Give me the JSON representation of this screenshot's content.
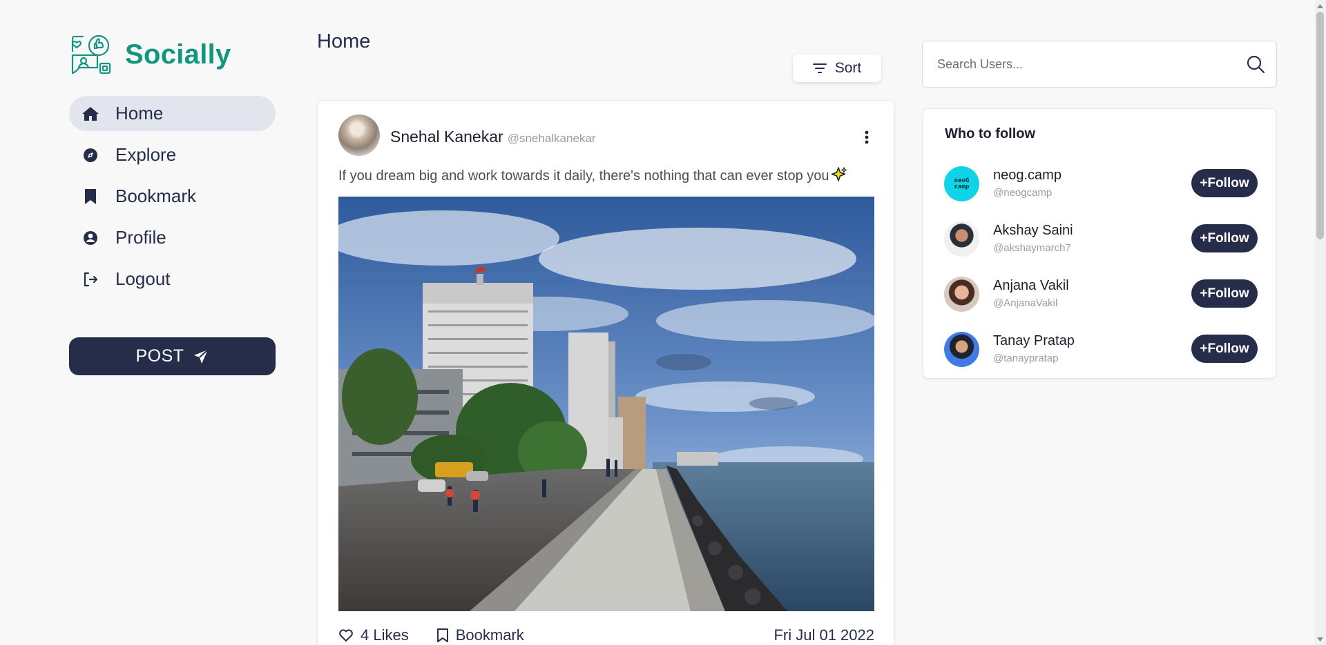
{
  "brand": {
    "name": "Socially",
    "logo_icon": "social-media-logo-icon",
    "color": "#12967f"
  },
  "nav": {
    "items": [
      {
        "label": "Home",
        "icon": "home-icon",
        "active": true
      },
      {
        "label": "Explore",
        "icon": "compass-icon",
        "active": false
      },
      {
        "label": "Bookmark",
        "icon": "bookmark-icon",
        "active": false
      },
      {
        "label": "Profile",
        "icon": "user-circle-icon",
        "active": false
      },
      {
        "label": "Logout",
        "icon": "logout-icon",
        "active": false
      }
    ],
    "post_label": "POST",
    "post_icon": "send-icon"
  },
  "main": {
    "title": "Home",
    "sort_label": "Sort",
    "post": {
      "author_name": "Snehal Kanekar",
      "author_handle": "@snehalkanekar",
      "text": "If you dream big and work towards it daily, there's nothing that can ever stop you",
      "emoji": "sparkles-icon",
      "likes_label": "4 Likes",
      "bookmark_label": "Bookmark",
      "date": "Fri Jul 01 2022"
    }
  },
  "search": {
    "placeholder": "Search Users..."
  },
  "who_to_follow": {
    "title": "Who to follow",
    "users": [
      {
        "name": "neog.camp",
        "handle": "@neogcamp",
        "button": "+Follow",
        "avatar_text_1": "neoG",
        "avatar_text_2": "camp"
      },
      {
        "name": "Akshay Saini",
        "handle": "@akshaymarch7",
        "button": "+Follow"
      },
      {
        "name": "Anjana Vakil",
        "handle": "@AnjanaVakil",
        "button": "+Follow"
      },
      {
        "name": "Tanay Pratap",
        "handle": "@tanaypratap",
        "button": "+Follow"
      }
    ]
  },
  "colors": {
    "accent": "#252d4a",
    "nav_active_bg": "#e2e4ee",
    "background": "#f8f8f9"
  }
}
